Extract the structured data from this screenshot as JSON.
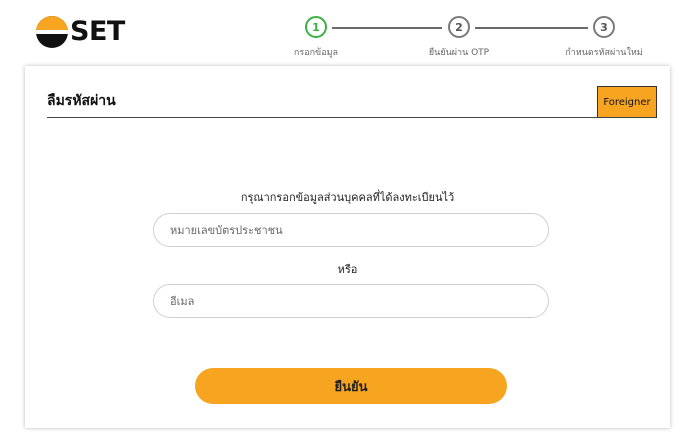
{
  "brand": {
    "logo_text": "SET"
  },
  "stepper": {
    "steps": [
      {
        "number": "1",
        "label": "กรอกข้อมูล",
        "state": "active"
      },
      {
        "number": "2",
        "label": "ยืนยันผ่าน OTP",
        "state": "inactive"
      },
      {
        "number": "3",
        "label": "กำหนดรหัสผ่านใหม่",
        "state": "inactive"
      }
    ]
  },
  "form": {
    "title": "ลืมรหัสผ่าน",
    "foreigner_button": "Foreigner",
    "instruction": "กรุณากรอกข้อมูลส่วนบุคคลที่ได้ลงทะเบียนไว้",
    "id_placeholder": "หมายเลขบัตรประชาชน",
    "or_text": "หรือ",
    "email_placeholder": "อีเมล",
    "confirm_button": "ยืนยัน"
  },
  "colors": {
    "accent": "#f7a521",
    "active_step": "#3cb043"
  }
}
